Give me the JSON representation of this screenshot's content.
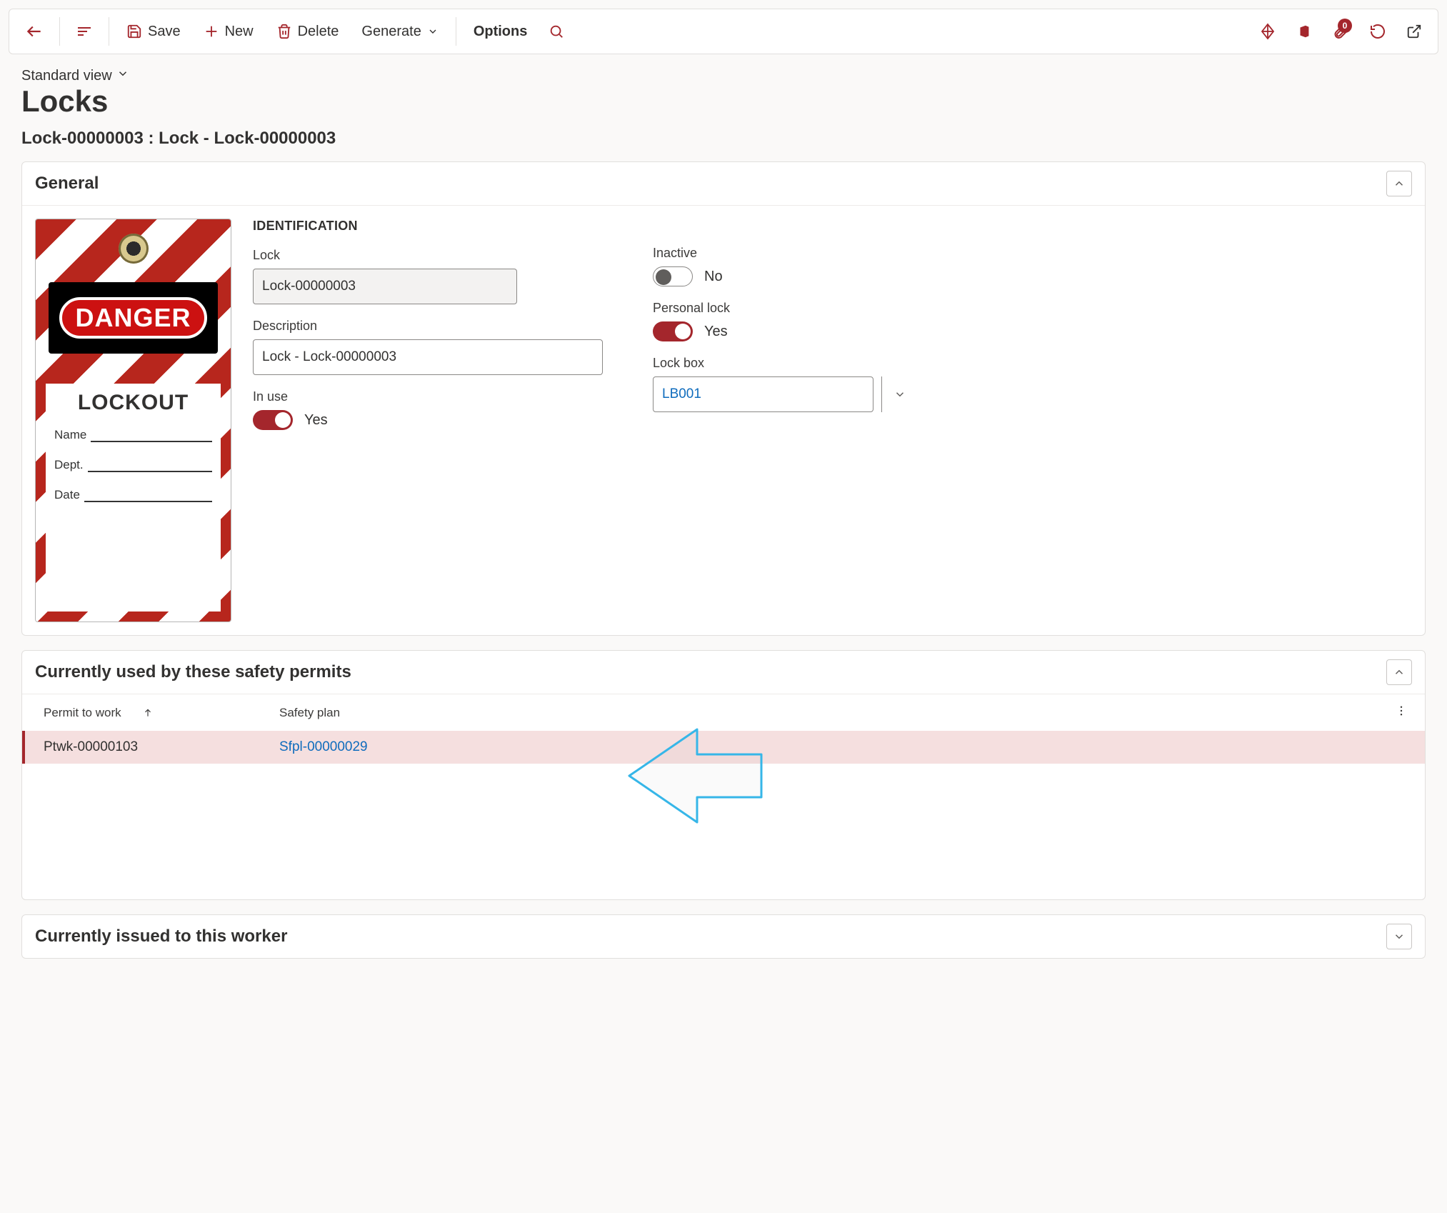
{
  "toolbar": {
    "save": "Save",
    "new": "New",
    "delete": "Delete",
    "generate": "Generate",
    "options": "Options",
    "attach_badge": "0"
  },
  "view": {
    "selector": "Standard view"
  },
  "page_title": "Locks",
  "record_title": "Lock-00000003 : Lock - Lock-00000003",
  "panels": {
    "general": "General",
    "permits": "Currently used by these safety permits",
    "worker": "Currently issued to this worker"
  },
  "general": {
    "section": "IDENTIFICATION",
    "lock_label": "Lock",
    "lock_value": "Lock-00000003",
    "desc_label": "Description",
    "desc_value": "Lock - Lock-00000003",
    "inuse_label": "In use",
    "inuse_value": "Yes",
    "inactive_label": "Inactive",
    "inactive_value": "No",
    "personal_label": "Personal lock",
    "personal_value": "Yes",
    "lockbox_label": "Lock box",
    "lockbox_value": "LB001"
  },
  "tag": {
    "danger": "DANGER",
    "lockout": "LOCKOUT",
    "name": "Name",
    "dept": "Dept.",
    "date": "Date"
  },
  "grid": {
    "col1": "Permit to work",
    "col2": "Safety plan",
    "rows": [
      {
        "permit": "Ptwk-00000103",
        "plan": "Sfpl-00000029"
      }
    ]
  }
}
